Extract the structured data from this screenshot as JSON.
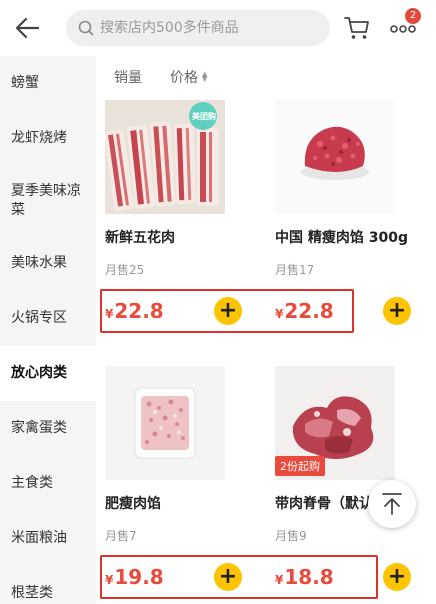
{
  "header": {
    "search_placeholder": "搜索店内500多件商品",
    "cart_badge": "2"
  },
  "sidebar": {
    "items": [
      {
        "label": "螃蟹",
        "active": false
      },
      {
        "label": "龙虾烧烤",
        "active": false
      },
      {
        "label": "夏季美味凉菜",
        "active": false
      },
      {
        "label": "美味水果",
        "active": false
      },
      {
        "label": "火锅专区",
        "active": false
      },
      {
        "label": "放心肉类",
        "active": true
      },
      {
        "label": "家禽蛋类",
        "active": false
      },
      {
        "label": "主食类",
        "active": false
      },
      {
        "label": "米面粮油",
        "active": false
      },
      {
        "label": "根茎类",
        "active": false
      }
    ]
  },
  "sort": {
    "sales_label": "销量",
    "price_label": "价格"
  },
  "products": [
    {
      "name": "新鲜五花肉",
      "sold": "月售25",
      "currency": "¥",
      "price": "22.8",
      "image": "pork-belly-slices",
      "image_logo": "美团购"
    },
    {
      "name": "中国 精瘦肉馅  300g",
      "sold": "月售17",
      "currency": "¥",
      "price": "22.8",
      "image": "minced-lean-pork"
    },
    {
      "name": "肥瘦肉馅",
      "sold": "月售7",
      "currency": "¥",
      "price": "19.8",
      "image": "fat-lean-mince-tray"
    },
    {
      "name": "带肉脊骨（默认",
      "sold": "月售9",
      "currency": "¥",
      "price": "18.8",
      "image": "pork-spine-bones",
      "tag": "2份起购"
    }
  ],
  "icons": {
    "back": "back-arrow-icon",
    "search": "search-icon",
    "cart": "cart-icon",
    "more": "more-icon",
    "add": "plus-icon",
    "totop": "back-to-top-icon"
  },
  "colors": {
    "price": "#e84b3c",
    "add_button": "#ffc400",
    "highlight": "#e0302a",
    "badge": "#e04a3a"
  }
}
